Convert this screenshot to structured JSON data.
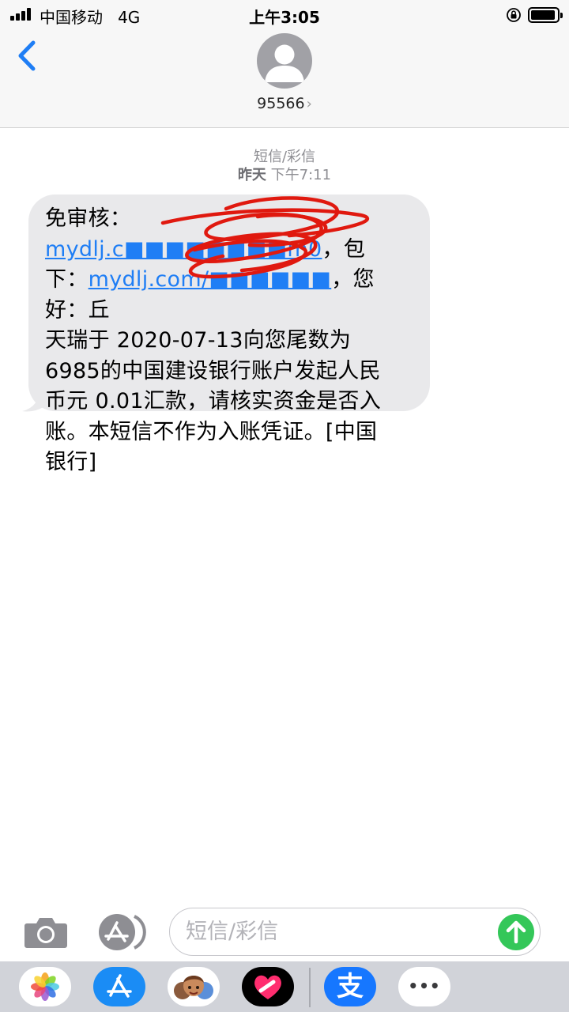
{
  "status_bar": {
    "carrier": "中国移动",
    "network": "4G",
    "time": "上午3:05"
  },
  "header": {
    "contact": "95566",
    "chevron": "›",
    "back_icon": "chevron-left-icon",
    "avatar_icon": "person-silhouette-icon"
  },
  "conversation": {
    "type_label": "短信/彩信",
    "date_label": "昨天",
    "time_label": "下午7:11"
  },
  "message": {
    "line1_text": "免审核：",
    "line1_link": "mydlj.c■■■■■■■■m0",
    "line1_end": "，包",
    "line2_text": "下：",
    "line2_link": "mydlj.com/■■■■■■",
    "line2_end": "，您好：丘",
    "line3": "天瑞于 2020-07-13向您尾数为",
    "line4": "6985的中国建设银行账户发起人民",
    "line5": "币元 0.01汇款，请核实资金是否入",
    "line6": "账。本短信不作为入账凭证。[中国",
    "line7": "银行]"
  },
  "input_bar": {
    "placeholder": "短信/彩信",
    "camera_icon": "camera-icon",
    "apps_icon": "app-store-icon",
    "send_icon": "arrow-up-icon"
  },
  "app_drawer": {
    "apps": [
      "photos-icon",
      "app-store-icon",
      "memoji-icon",
      "heart-icon",
      "alipay-icon",
      "more-icon"
    ],
    "alipay_glyph": "支",
    "more_glyph": "•••"
  },
  "colors": {
    "link": "#1f7ef5",
    "bubble": "#e9e9eb",
    "send": "#34c759",
    "back": "#1f7ef5",
    "scribble": "#e0190f",
    "alipay": "#1677ff"
  }
}
